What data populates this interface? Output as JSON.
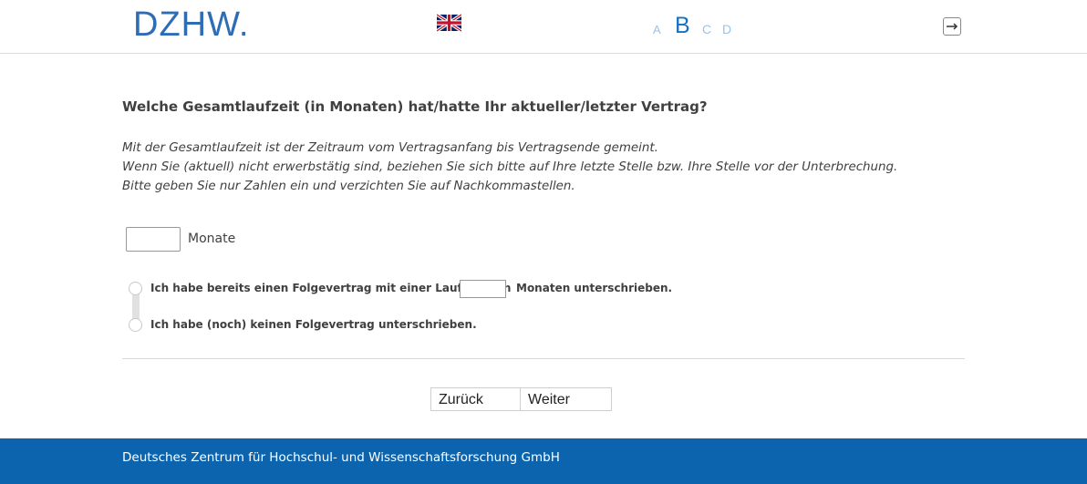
{
  "header": {
    "logo_text": "DZHW.",
    "language_flag": "uk-flag-icon",
    "font_sizes": [
      "A",
      "B",
      "C",
      "D"
    ],
    "logout_icon": "logout-icon"
  },
  "question": {
    "title": "Welche Gesamtlaufzeit (in Monaten) hat/hatte Ihr aktueller/letzter Vertrag?",
    "hints": [
      "Mit der Gesamtlaufzeit ist der Zeitraum vom Vertragsanfang bis Vertragsende gemeint.",
      "Wenn Sie (aktuell) nicht erwerbstätig sind, beziehen Sie sich bitte auf Ihre letzte Stelle bzw. Ihre Stelle vor der Unterbrechung.",
      "Bitte geben Sie nur Zahlen ein und verzichten Sie auf Nachkommastellen."
    ],
    "months_value": "",
    "months_label": "Monate"
  },
  "options": {
    "opt1_before": "Ich habe bereits einen Folgevertrag mit einer Laufzeit von",
    "opt1_value": "",
    "opt1_after": "Monaten unterschrieben.",
    "opt2": "Ich habe (noch) keinen Folgevertrag unterschrieben."
  },
  "nav": {
    "back_label": "Zurück",
    "next_label": "Weiter"
  },
  "footer": {
    "text": "Deutsches Zentrum für Hochschul- und Wissenschaftsforschung GmbH"
  },
  "colors": {
    "brand": "#2d6db5",
    "footer": "#0b64ad"
  }
}
